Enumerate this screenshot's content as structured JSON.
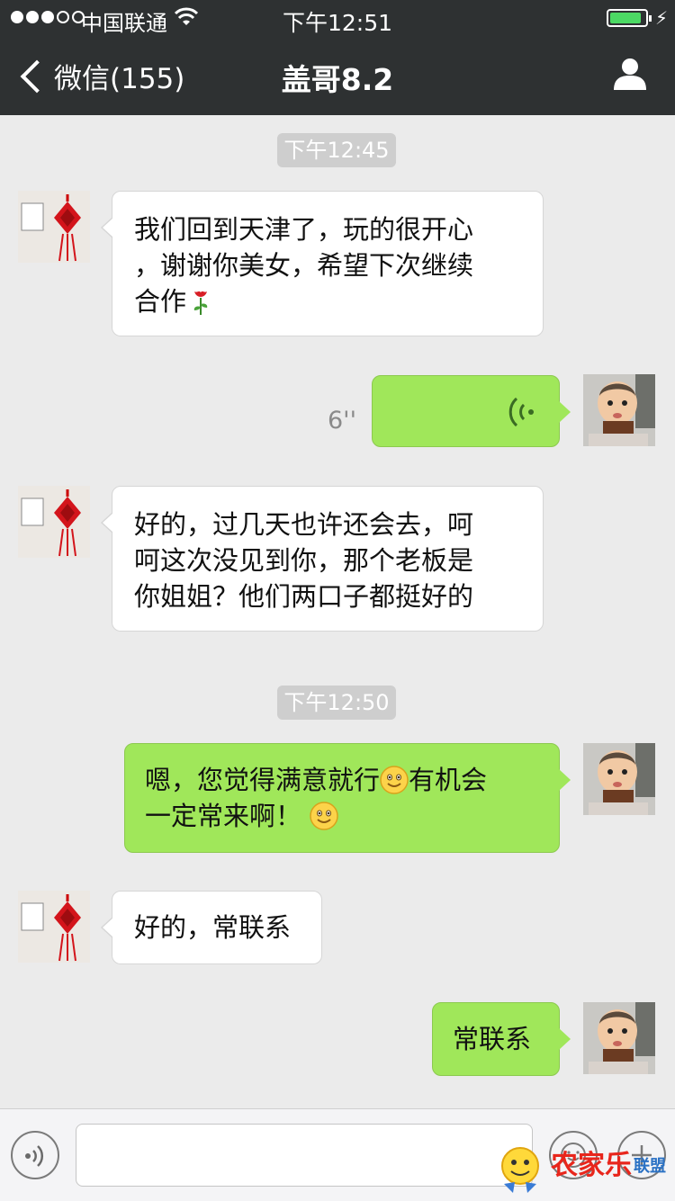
{
  "status_bar": {
    "carrier": "中国联通",
    "time": "下午12:51"
  },
  "nav": {
    "back_label": "微信(155)",
    "title": "盖哥8.2"
  },
  "messages": {
    "time1": "下午12:45",
    "m1_line1": "我们回到天津了，玩的很开心",
    "m1_line2": "，谢谢你美女，希望下次继续",
    "m1_line3": "合作",
    "voice_duration": "6''",
    "m3_line1": "好的，过几天也许还会去，呵",
    "m3_line2": "呵这次没见到你，那个老板是",
    "m3_line3": "你姐姐？他们两口子都挺好的",
    "time2": "下午12:50",
    "m4_line1_a": "嗯，您觉得满意就行",
    "m4_line1_b": "有机会",
    "m4_line2": "一定常来啊！",
    "m5": "好的，常联系",
    "m6": "常联系"
  },
  "input": {
    "value": "",
    "placeholder": ""
  },
  "watermark": {
    "text": "农家乐",
    "sub": "联盟"
  },
  "icons": {
    "back": "chevron-left-icon",
    "profile": "person-icon",
    "voice": "voice-wave-icon",
    "emoji": "smiley-icon",
    "rose": "rose-icon",
    "plus": "plus-icon"
  },
  "colors": {
    "nav_bg": "#2e3132",
    "chat_bg": "#ebebeb",
    "my_bubble": "#a0e75a",
    "their_bubble": "#ffffff",
    "time_badge": "#cecece"
  }
}
